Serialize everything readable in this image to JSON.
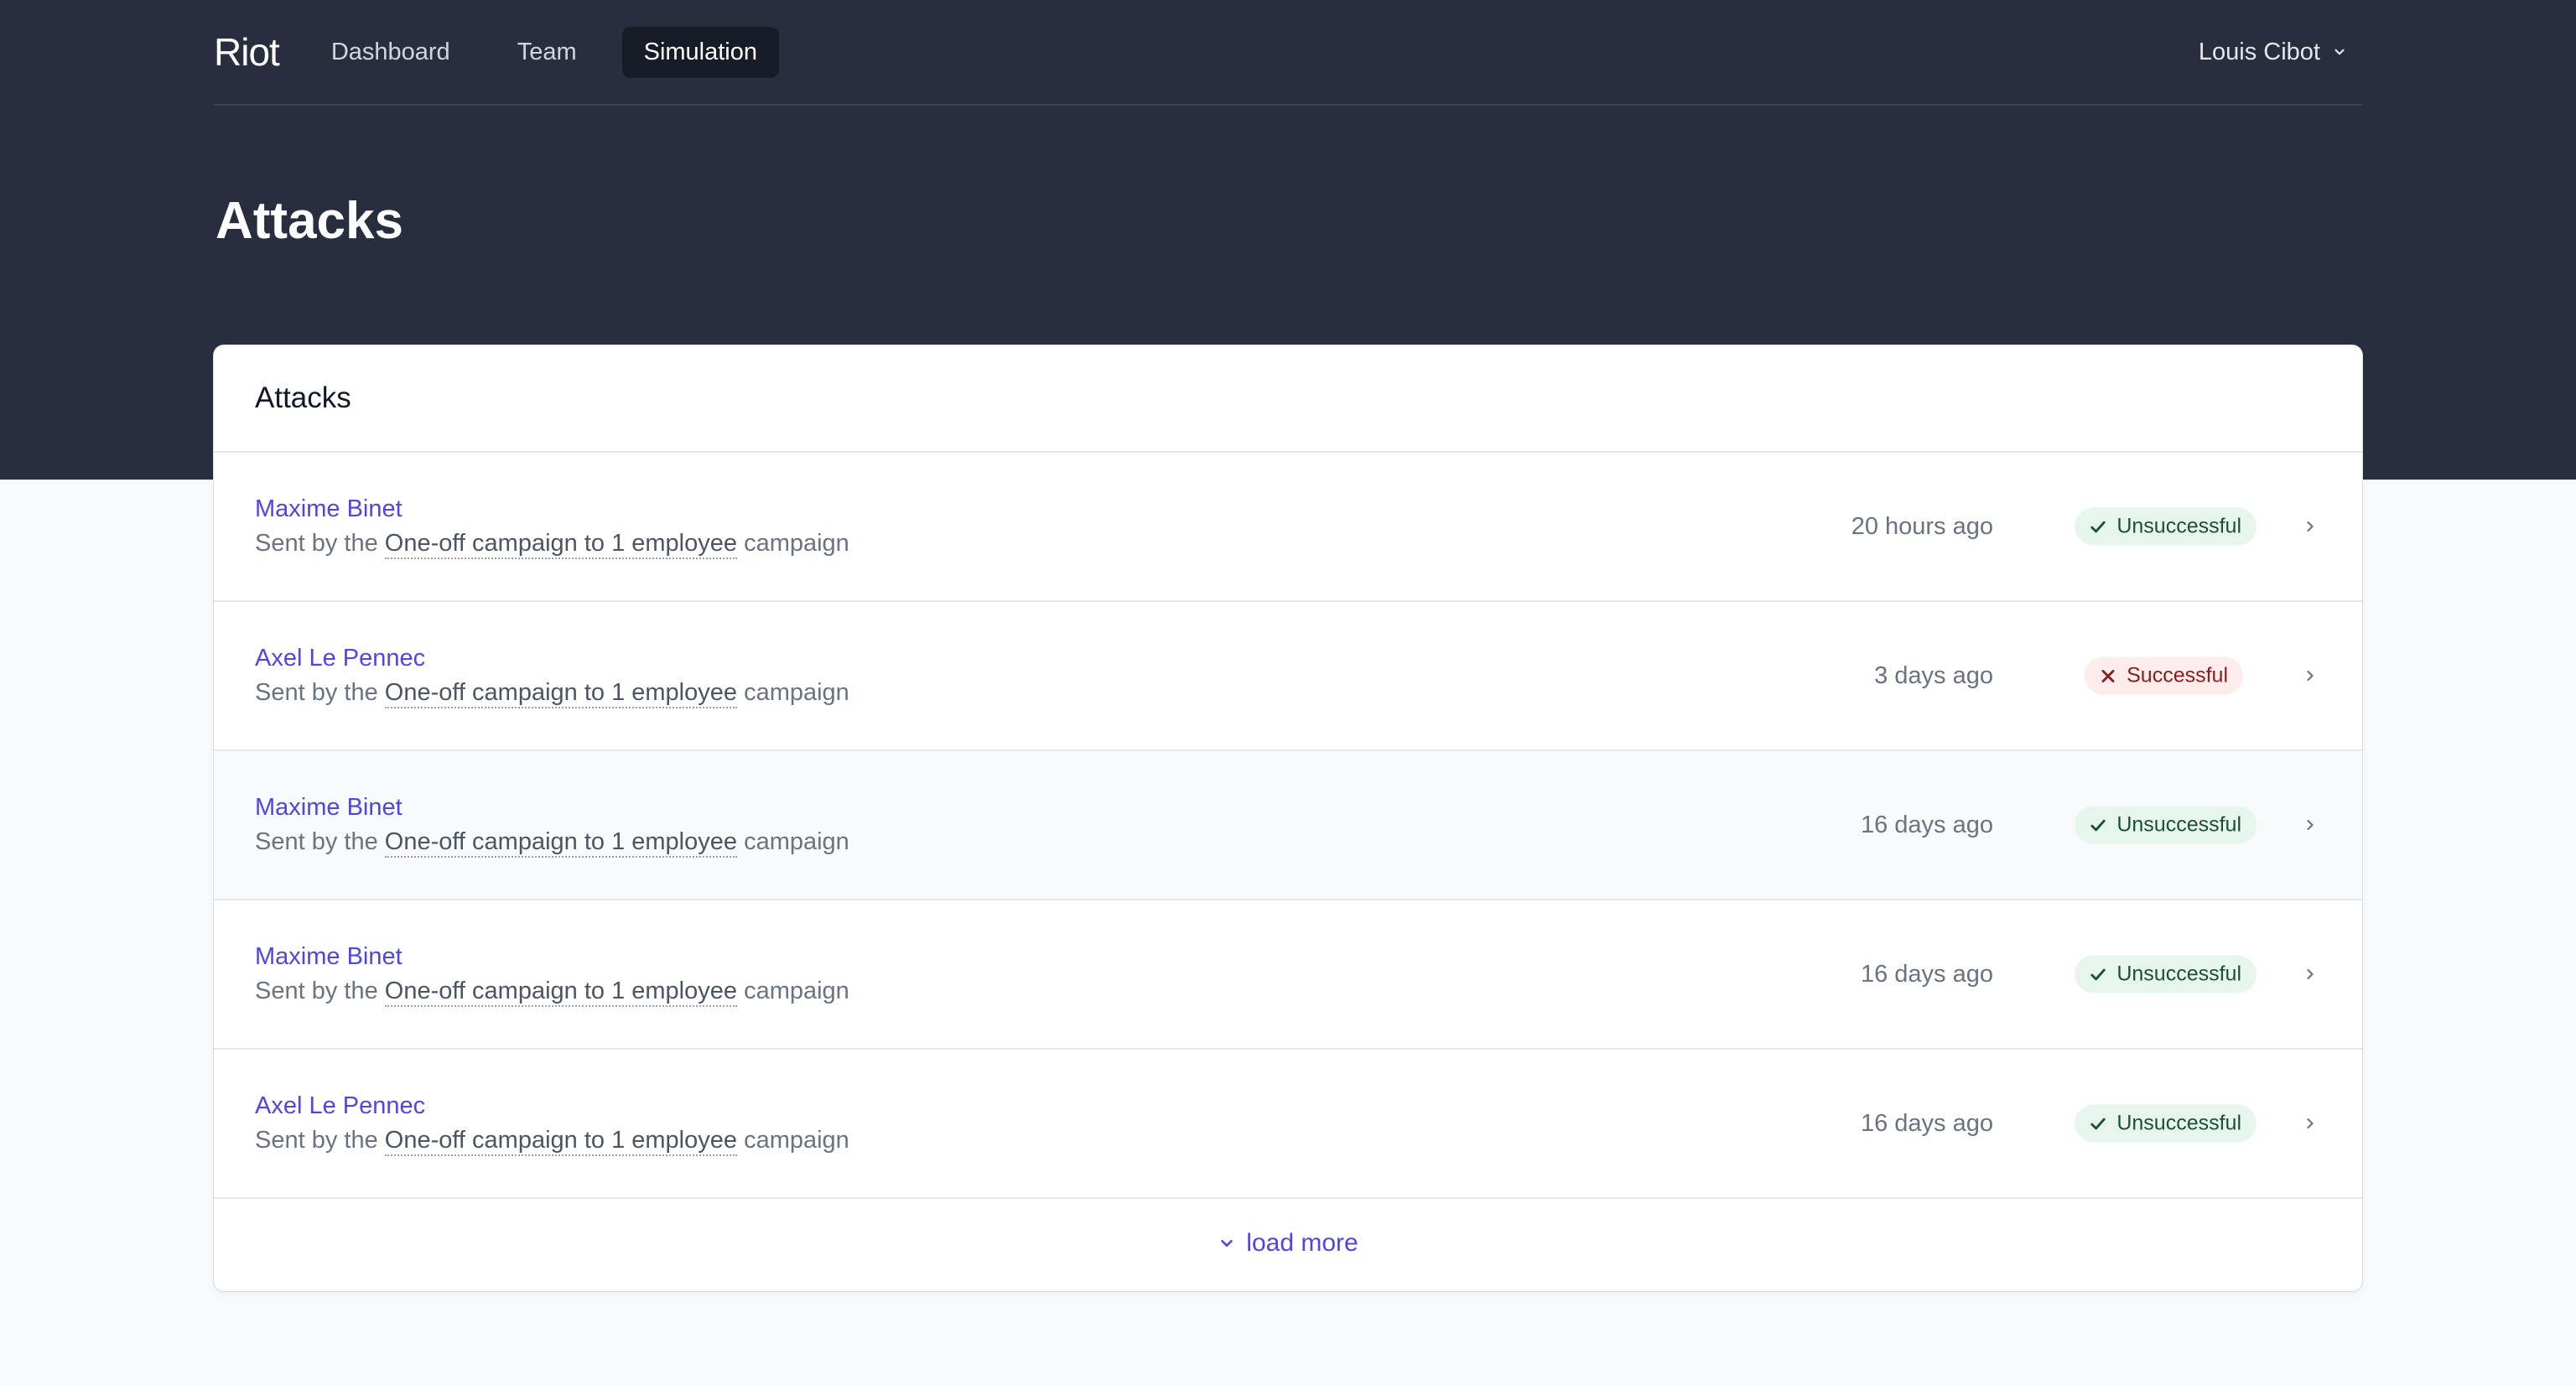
{
  "nav": {
    "logo": "Riot",
    "items": [
      {
        "label": "Dashboard",
        "active": false
      },
      {
        "label": "Team",
        "active": false
      },
      {
        "label": "Simulation",
        "active": true
      }
    ],
    "user_name": "Louis Cibot"
  },
  "page": {
    "title": "Attacks"
  },
  "card": {
    "title": "Attacks",
    "load_more_label": "load more",
    "rows": [
      {
        "name": "Maxime Binet",
        "sent_prefix": "Sent by the",
        "campaign": "One-off campaign to 1 employee",
        "sent_suffix": "campaign",
        "time": "20 hours ago",
        "status": "Unsuccessful"
      },
      {
        "name": "Axel Le Pennec",
        "sent_prefix": "Sent by the",
        "campaign": "One-off campaign to 1 employee",
        "sent_suffix": "campaign",
        "time": "3 days ago",
        "status": "Successful"
      },
      {
        "name": "Maxime Binet",
        "sent_prefix": "Sent by the",
        "campaign": "One-off campaign to 1 employee",
        "sent_suffix": "campaign",
        "time": "16 days ago",
        "status": "Unsuccessful"
      },
      {
        "name": "Maxime Binet",
        "sent_prefix": "Sent by the",
        "campaign": "One-off campaign to 1 employee",
        "sent_suffix": "campaign",
        "time": "16 days ago",
        "status": "Unsuccessful"
      },
      {
        "name": "Axel Le Pennec",
        "sent_prefix": "Sent by the",
        "campaign": "One-off campaign to 1 employee",
        "sent_suffix": "campaign",
        "time": "16 days ago",
        "status": "Unsuccessful"
      }
    ]
  },
  "colors": {
    "header_bg": "#282e3d",
    "accent": "#4f46e5",
    "unsuccessful_bg": "#e6f6ef",
    "successful_bg": "#fdecec"
  }
}
